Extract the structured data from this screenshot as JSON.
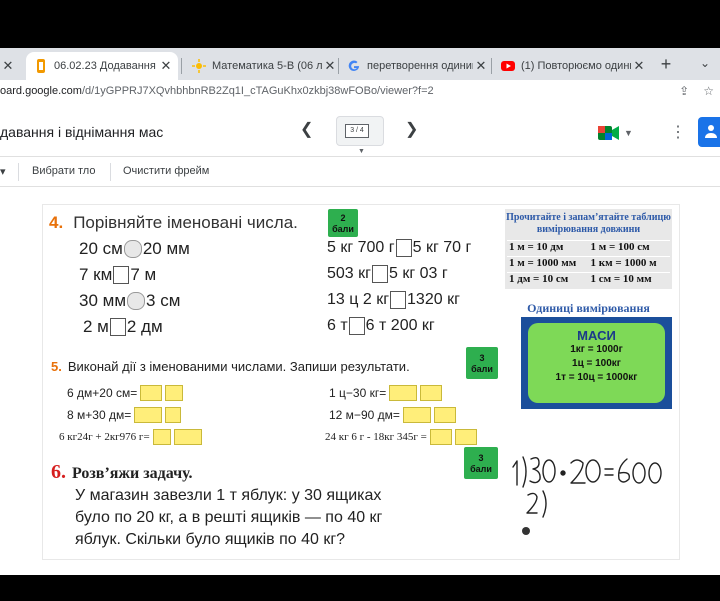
{
  "browser": {
    "tabs": [
      {
        "title": "",
        "active": false
      },
      {
        "title": "06.02.23 Додавання і від",
        "active": true
      },
      {
        "title": "Математика 5-В (06 лют",
        "active": false
      },
      {
        "title": "перетворення одиниць",
        "active": false
      },
      {
        "title": "(1) Повторюємо одиниці",
        "active": false
      }
    ],
    "new_tab": "+",
    "url_host": "oard.google.com",
    "url_path": "/d/1yGPPRJ7XQvhbhbnRB2Zq1I_cTAGuKhx0zkbj38wFOBo/viewer?f=2"
  },
  "jamboard": {
    "title": "давання і віднімання мас",
    "frame_indicator": "3 / 4",
    "toolbar": {
      "set_background": "Вибрати тло",
      "clear_frame": "Очистити фрейм"
    }
  },
  "task4": {
    "number": "4.",
    "title": "Порівняйте іменовані числа.",
    "badge": [
      "2",
      "бали"
    ],
    "left": [
      [
        "20 см",
        "20 мм"
      ],
      [
        "7 км",
        "7 м"
      ],
      [
        "30 мм",
        "3 см"
      ],
      [
        "2 м",
        "2 дм"
      ]
    ],
    "right": [
      [
        "5 кг 700 г",
        "5 кг 70 г"
      ],
      [
        "503 кг",
        "5 кг 03 г"
      ],
      [
        "13 ц 2 кг",
        "1320 кг"
      ],
      [
        "6 т",
        "6 т 200 кг"
      ]
    ]
  },
  "reference": {
    "caption1": "Прочитайте і запам’ятайте таблицю",
    "caption2": "вимірювання довжини",
    "rows": [
      [
        "1 м = 10 дм",
        "1 м = 100 см"
      ],
      [
        "1 м = 1000 мм",
        "1 км = 1000 м"
      ],
      [
        "1 дм = 10 см",
        "1 см = 10 мм"
      ]
    ],
    "units_title": "Одиниці вимірювання",
    "mass_title": "МАСИ",
    "mass_lines": [
      "1кг = 1000г",
      "1ц = 100кг",
      "1т = 10ц = 1000кг"
    ]
  },
  "task5": {
    "number": "5.",
    "title": "Виконай дії з іменованими числами. Запиши результати.",
    "badge": [
      "3",
      "бали"
    ],
    "left": [
      "6 дм+20 см=",
      "8 м+30 дм=",
      "6 кг24г + 2кг976 г="
    ],
    "right": [
      "1 ц−30 кг=",
      "12 м−90 дм=",
      "24 кг 6 г - 18кг 345г ="
    ]
  },
  "task6": {
    "number": "6.",
    "title": "Розв’яжи задачу.",
    "badge": [
      "3",
      "бали"
    ],
    "lines": [
      "У магазин завезли 1 т яблук: у 30 ящиках",
      "було по 20 кг, а в решті ящиків — по 40 кг",
      "яблук. Скільки було ящиків по 40 кг?"
    ]
  },
  "handwriting": {
    "line1": "1) 30 · 20 = 600",
    "line2": "2)"
  }
}
